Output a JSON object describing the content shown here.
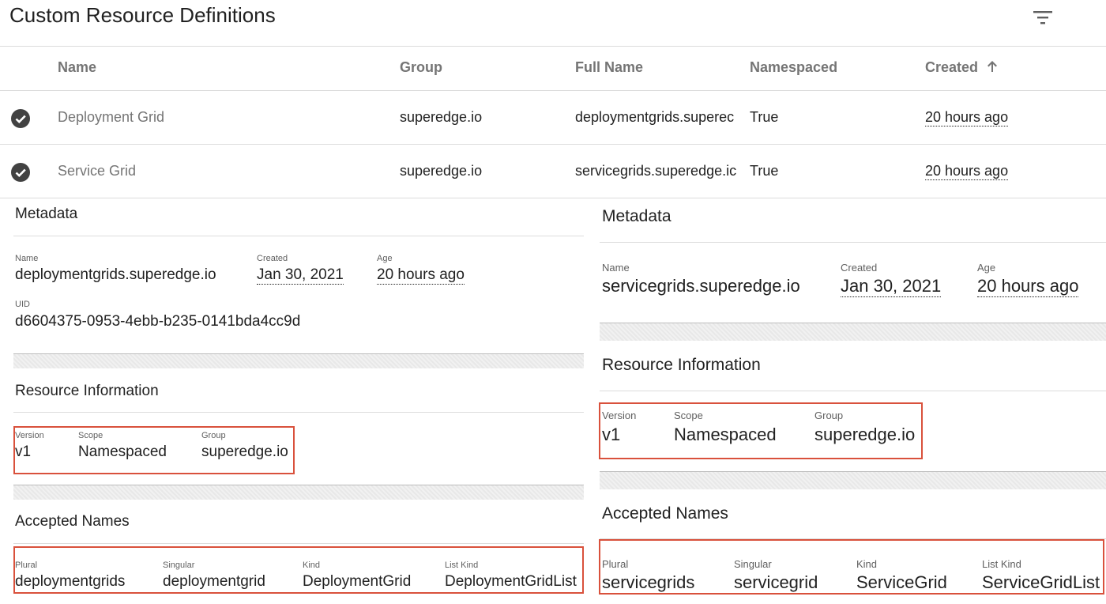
{
  "page": {
    "title": "Custom Resource Definitions"
  },
  "table": {
    "headers": {
      "name": "Name",
      "group": "Group",
      "full_name": "Full Name",
      "namespaced": "Namespaced",
      "created": "Created"
    },
    "rows": [
      {
        "name": "Deployment Grid",
        "group": "superedge.io",
        "full_name": "deploymentgrids.superec",
        "namespaced": "True",
        "created": "20 hours ago"
      },
      {
        "name": "Service Grid",
        "group": "superedge.io",
        "full_name": "servicegrids.superedge.ic",
        "namespaced": "True",
        "created": "20 hours ago"
      }
    ]
  },
  "left": {
    "metadata": {
      "title": "Metadata",
      "name_label": "Name",
      "name": "deploymentgrids.superedge.io",
      "created_label": "Created",
      "created": "Jan 30, 2021",
      "age_label": "Age",
      "age": "20 hours ago",
      "uid_label": "UID",
      "uid": "d6604375-0953-4ebb-b235-0141bda4cc9d"
    },
    "resource": {
      "title": "Resource Information",
      "version_label": "Version",
      "version": "v1",
      "scope_label": "Scope",
      "scope": "Namespaced",
      "group_label": "Group",
      "group": "superedge.io"
    },
    "accepted": {
      "title": "Accepted Names",
      "plural_label": "Plural",
      "plural": "deploymentgrids",
      "singular_label": "Singular",
      "singular": "deploymentgrid",
      "kind_label": "Kind",
      "kind": "DeploymentGrid",
      "listkind_label": "List Kind",
      "listkind": "DeploymentGridList"
    }
  },
  "right": {
    "metadata": {
      "title": "Metadata",
      "name_label": "Name",
      "name": "servicegrids.superedge.io",
      "created_label": "Created",
      "created": "Jan 30, 2021",
      "age_label": "Age",
      "age": "20 hours ago"
    },
    "resource": {
      "title": "Resource Information",
      "version_label": "Version",
      "version": "v1",
      "scope_label": "Scope",
      "scope": "Namespaced",
      "group_label": "Group",
      "group": "superedge.io"
    },
    "accepted": {
      "title": "Accepted Names",
      "plural_label": "Plural",
      "plural": "servicegrids",
      "singular_label": "Singular",
      "singular": "servicegrid",
      "kind_label": "Kind",
      "kind": "ServiceGrid",
      "listkind_label": "List Kind",
      "listkind": "ServiceGridList"
    }
  },
  "icons": {
    "filter": "filter-icon",
    "check": "check-circle-icon",
    "sort": "arrow-up-icon"
  },
  "colors": {
    "highlight": "#d9513c",
    "check": "#424242"
  }
}
